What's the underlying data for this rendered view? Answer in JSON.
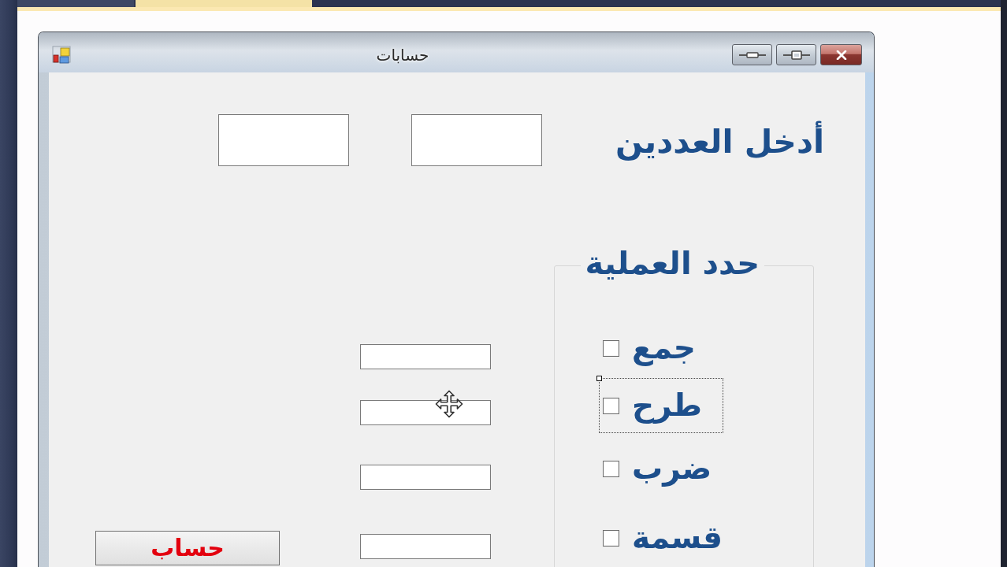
{
  "document_tabs": [
    {
      "selected": false
    },
    {
      "selected": true
    }
  ],
  "form": {
    "title": "حسابات",
    "prompt": "أدخل العددين",
    "operations": {
      "title": "حدد العملية",
      "options": [
        {
          "label": "جمع",
          "checked": false,
          "selected": false
        },
        {
          "label": "طرح",
          "checked": false,
          "selected": true
        },
        {
          "label": "ضرب",
          "checked": false,
          "selected": false
        },
        {
          "label": "قسمة",
          "checked": false,
          "selected": false
        }
      ]
    },
    "calculate_button": {
      "label": "حساب"
    }
  }
}
